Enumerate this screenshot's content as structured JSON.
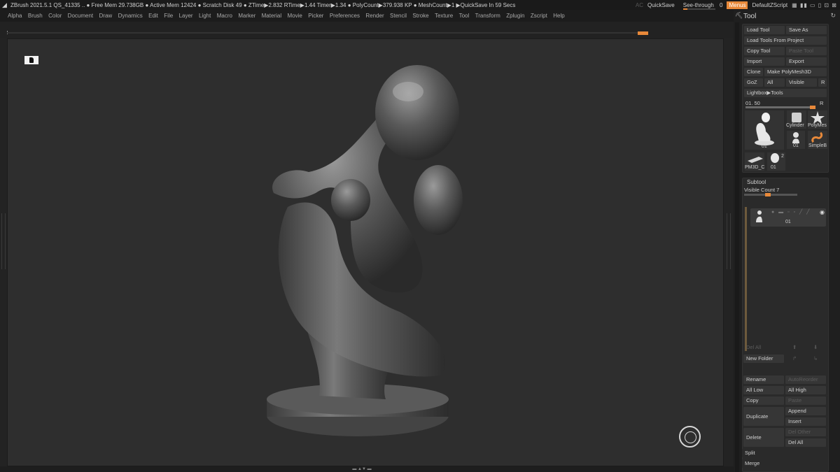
{
  "titlebar": {
    "status": "ZBrush 2021.5.1    QS_41335    .. ● Free Mem 29.738GB ● Active Mem 12424 ● Scratch Disk 49 ● ZTime▶2.832 RTime▶1.44 Timer▶1.34 ● PolyCount▶379.938 KP ● MeshCount▶1 ▶QuickSave In 59 Secs",
    "ac": "AC",
    "quicksave": "QuickSave",
    "see_through": "See-through",
    "see_through_value": "0",
    "see_through_level": 0,
    "menus": "Menus",
    "script": "DefaultZScript",
    "accent": "#e8893a"
  },
  "menubar": [
    "Alpha",
    "Brush",
    "Color",
    "Document",
    "Draw",
    "Dynamics",
    "Edit",
    "File",
    "Layer",
    "Light",
    "Macro",
    "Marker",
    "Material",
    "Movie",
    "Picker",
    "Preferences",
    "Render",
    "Stencil",
    "Stroke",
    "Texture",
    "Tool",
    "Transform",
    "Zplugin",
    "Zscript",
    "Help"
  ],
  "panel": {
    "title": "Tool",
    "load_tool": "Load Tool",
    "save_as": "Save As",
    "load_from_project": "Load Tools From Project",
    "copy_tool": "Copy Tool",
    "paste_tool": "Paste Tool",
    "import": "Import",
    "export": "Export",
    "clone": "Clone",
    "make_polymesh": "Make PolyMesh3D",
    "goz": "GoZ",
    "all": "All",
    "visible": "Visible",
    "r": "R",
    "lightbox_tools": "Lightbox▶Tools",
    "tool_slider_value": "01. 50",
    "tool_slider_r": "R",
    "thumbs": {
      "main": "01",
      "cylinder": "Cylinder",
      "polymesh": "PolyMes",
      "small01": "01",
      "simpleb": "SimpleB",
      "pm3d": "PM3D_C",
      "head01": "01",
      "head_count": "2"
    },
    "subtool": {
      "title": "Subtool",
      "visible_count": "Visible Count 7",
      "item_label": "01",
      "del_all": "Del All",
      "new_folder": "New Folder",
      "rename": "Rename",
      "autoreorder": "AutoReorder",
      "all_low": "All Low",
      "all_high": "All High",
      "copy": "Copy",
      "paste": "Paste",
      "duplicate": "Duplicate",
      "append": "Append",
      "insert": "Insert",
      "delete": "Delete",
      "del_other": "Del Other",
      "del_all_2": "Del All",
      "split": "Split",
      "merge": "Merge"
    }
  }
}
